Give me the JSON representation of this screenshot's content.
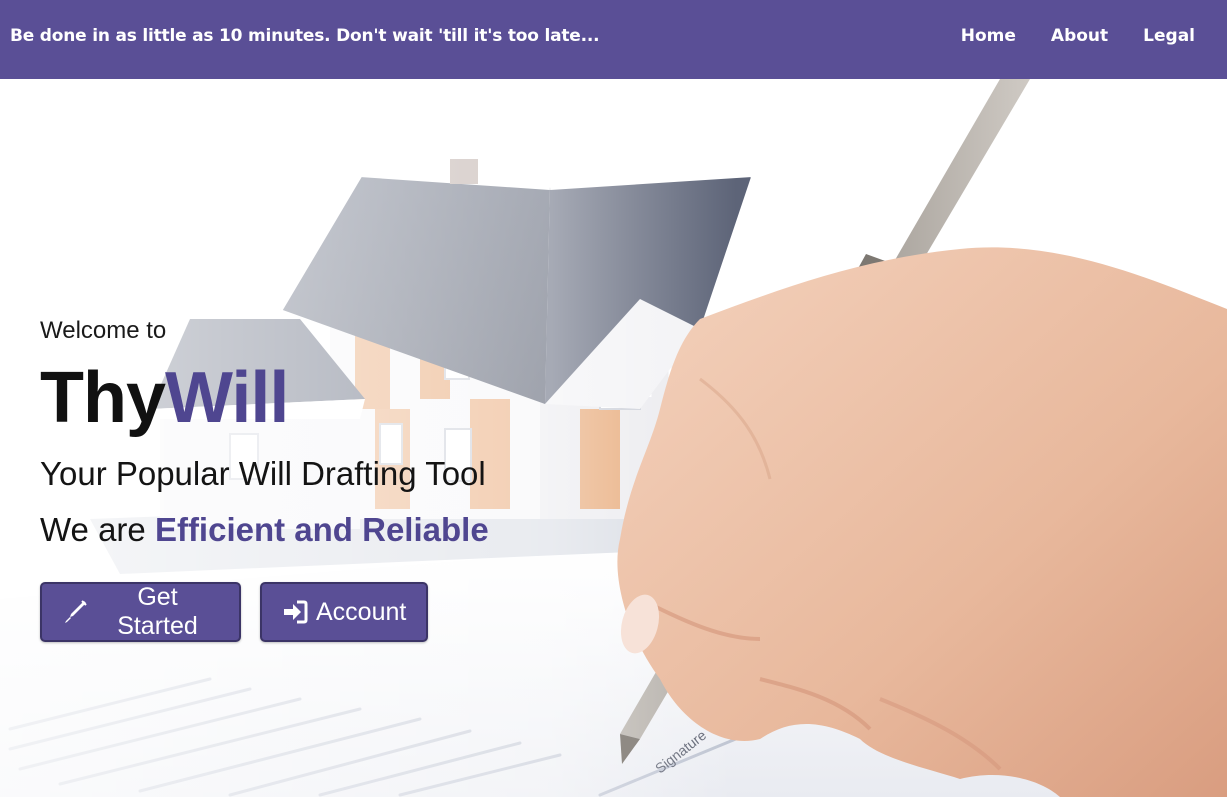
{
  "navbar": {
    "tagline": "Be done in as little as 10 minutes. Don't wait 'till it's too late...",
    "links": [
      {
        "label": "Home"
      },
      {
        "label": "About"
      },
      {
        "label": "Legal"
      }
    ]
  },
  "hero": {
    "welcome": "Welcome to",
    "brand_part1": "Thy",
    "brand_part2": "Will",
    "subtitle": "Your Popular Will Drafting Tool",
    "claim_prefix": "We are ",
    "claim_highlight": "Efficient and Reliable",
    "buttons": {
      "get_started": {
        "label": "Get Started",
        "icon": "pen-icon"
      },
      "account": {
        "label": "Account",
        "icon": "sign-in-icon"
      }
    },
    "background": "house-and-hand-writing-with-pen"
  },
  "colors": {
    "brand": "#5a4f96",
    "brand_text": "#4f4690",
    "nav_text": "#ffffff",
    "body_text": "#111111"
  }
}
